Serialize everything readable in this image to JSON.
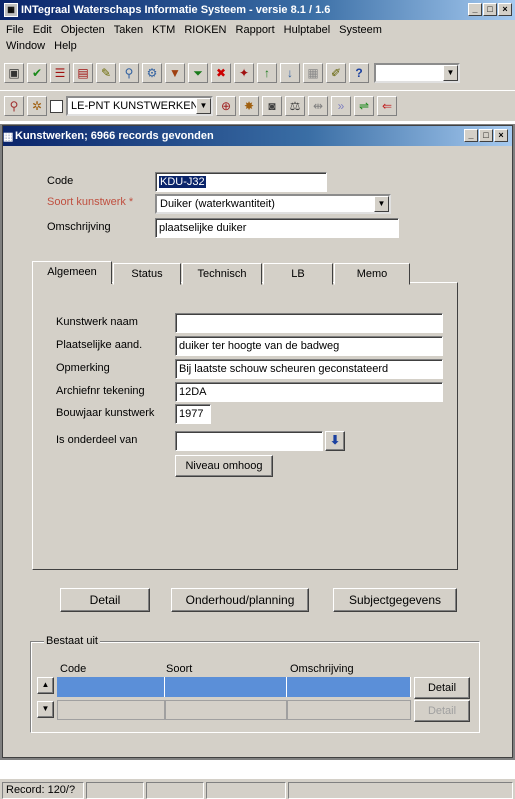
{
  "app": {
    "title": "INTegraal Waterschaps Informatie Systeem - versie 8.1 / 1.6",
    "menu_row1": [
      "File",
      "Edit",
      "Objecten",
      "Taken",
      "KTM",
      "RIOKEN",
      "Rapport",
      "Hulptabel",
      "Systeem"
    ],
    "menu_row2": [
      "Window",
      "Help"
    ]
  },
  "toolbar2": {
    "combo_value": "LE-PNT KUNSTWERKEN"
  },
  "child": {
    "title": "Kunstwerken; 6966 records gevonden"
  },
  "header_form": {
    "code_label": "Code",
    "code_value": "KDU-J32",
    "soort_label": "Soort kunstwerk *",
    "soort_value": "Duiker (waterkwantiteit)",
    "omschrijving_label": "Omschrijving",
    "omschrijving_value": "plaatselijke duiker"
  },
  "tabs": [
    "Algemeen",
    "Status",
    "Technisch",
    "LB",
    "Memo"
  ],
  "algemeen": {
    "naam_label": "Kunstwerk naam",
    "naam_value": "",
    "plaats_label": "Plaatselijke aand.",
    "plaats_value": "duiker ter hoogte van de badweg",
    "opmerking_label": "Opmerking",
    "opmerking_value": "Bij laatste schouw scheuren geconstateerd",
    "archief_label": "Archiefnr tekening",
    "archief_value": "12DA",
    "bouwjaar_label": "Bouwjaar kunstwerk",
    "bouwjaar_value": "1977",
    "onderdeel_label": "Is onderdeel van",
    "onderdeel_value": "",
    "niveau_button": "Niveau omhoog"
  },
  "buttons": {
    "detail": "Detail",
    "onderhoud": "Onderhoud/planning",
    "subject": "Subjectgegevens"
  },
  "bestaat_uit": {
    "group_label": "Bestaat uit",
    "columns": [
      "Code",
      "Soort",
      "Omschrijving"
    ],
    "detail1": "Detail",
    "detail2": "Detail"
  },
  "statusbar": {
    "record": "Record: 120/?"
  },
  "colors": {
    "titlebar": "#0a246a",
    "face": "#d4d0c8",
    "grid_selected": "#5b8fd8"
  }
}
